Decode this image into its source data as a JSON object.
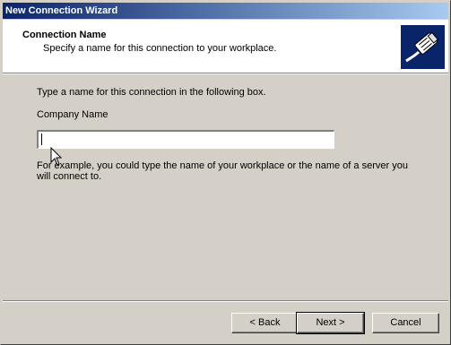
{
  "window": {
    "title": "New Connection Wizard"
  },
  "header": {
    "title": "Connection Name",
    "subtitle": "Specify a name for this connection to your workplace.",
    "icon": "network-cable-icon"
  },
  "main": {
    "prompt": "Type a name for this connection in the following box.",
    "field_label": "Company Name",
    "field_value": "",
    "example": "For example, you could type the name of your workplace or the name of a server you will connect to."
  },
  "buttons": {
    "back": "< Back",
    "next": "Next >",
    "cancel": "Cancel"
  },
  "colors": {
    "titlebar_start": "#0a246a",
    "titlebar_end": "#a6caf0",
    "dialog_bg": "#d4d0c8",
    "header_bg": "#ffffff"
  }
}
